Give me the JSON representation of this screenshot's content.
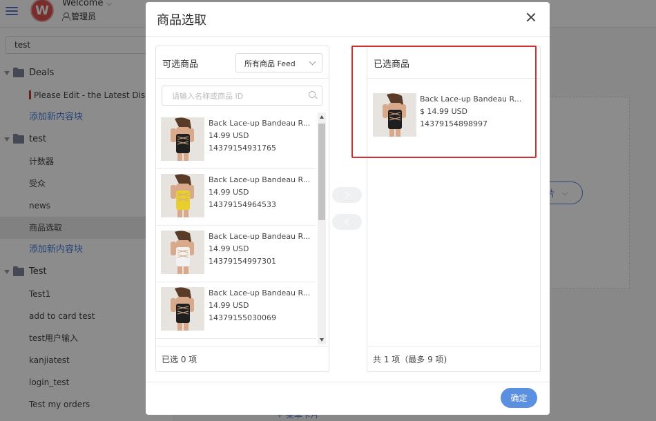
{
  "header": {
    "avatar_letter": "W",
    "welcome": "Welcome",
    "role": "管理员"
  },
  "sidebar": {
    "search_value": "test",
    "tree": [
      {
        "type": "folder",
        "label": "Deals"
      },
      {
        "type": "leaf",
        "label": "Please Edit - the Latest Discoun",
        "flag": true
      },
      {
        "type": "add",
        "label": "添加新内容块"
      },
      {
        "type": "folder",
        "label": "test"
      },
      {
        "type": "leaf",
        "label": "计数器"
      },
      {
        "type": "leaf",
        "label": "受众"
      },
      {
        "type": "leaf",
        "label": "news"
      },
      {
        "type": "leaf",
        "label": "商品选取",
        "active": true
      },
      {
        "type": "add",
        "label": "添加新内容块"
      },
      {
        "type": "folder",
        "label": "Test"
      },
      {
        "type": "leaf",
        "label": "Test1"
      },
      {
        "type": "leaf",
        "label": "add to card test"
      },
      {
        "type": "leaf",
        "label": "test用户输入"
      },
      {
        "type": "leaf",
        "label": "kanjiatest"
      },
      {
        "type": "leaf",
        "label": "login_test"
      },
      {
        "type": "leaf",
        "label": "Test my orders"
      }
    ]
  },
  "main": {
    "pill_label": "片",
    "bottom_text": "+ 菜单卡片"
  },
  "modal": {
    "title": "商品选取",
    "confirm_label": "确定",
    "left": {
      "title": "可选商品",
      "feed_select": "所有商品 Feed",
      "search_placeholder": "请输入名称或商品 ID",
      "footer": "已选 0 项",
      "items": [
        {
          "name": "Back Lace-up Bandeau R...",
          "price": "14.99 USD",
          "id": "14379154931765",
          "color": "black"
        },
        {
          "name": "Back Lace-up Bandeau R...",
          "price": "14.99 USD",
          "id": "14379154964533",
          "color": "yellow"
        },
        {
          "name": "Back Lace-up Bandeau R...",
          "price": "14.99 USD",
          "id": "14379154997301",
          "color": "white"
        },
        {
          "name": "Back Lace-up Bandeau R...",
          "price": "14.99 USD",
          "id": "14379155030069",
          "color": "black"
        }
      ]
    },
    "right": {
      "title": "已选商品",
      "footer": "共 1 项（最多 9 项)",
      "item": {
        "name": "Back Lace-up Bandeau R...",
        "price": "$ 14.99 USD",
        "id": "14379154898997",
        "color": "black"
      }
    },
    "colors": {
      "black": "#1f1f1f",
      "yellow": "#e8cf2c",
      "white": "#f2f2f2",
      "accent": "#5b8fe0",
      "highlight": "#d32f2f"
    }
  }
}
